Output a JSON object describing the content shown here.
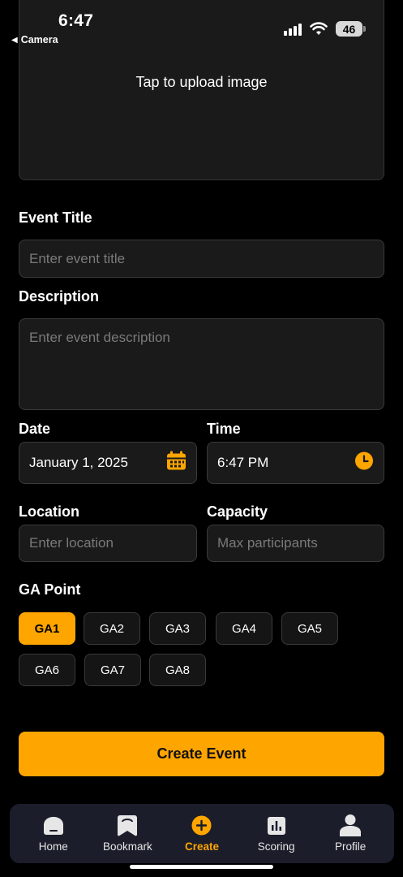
{
  "status": {
    "time": "6:47",
    "back_app": "Camera",
    "battery": "46"
  },
  "upload": {
    "prompt": "Tap to upload image"
  },
  "form": {
    "event_title": {
      "label": "Event Title",
      "placeholder": "Enter event title"
    },
    "description": {
      "label": "Description",
      "placeholder": "Enter event description"
    },
    "date": {
      "label": "Date",
      "value": "January 1, 2025",
      "icon": "calendar-icon"
    },
    "time": {
      "label": "Time",
      "value": "6:47 PM",
      "icon": "clock-icon"
    },
    "location": {
      "label": "Location",
      "placeholder": "Enter location"
    },
    "capacity": {
      "label": "Capacity",
      "placeholder": "Max participants"
    },
    "ga_point": {
      "label": "GA Point",
      "options": [
        "GA1",
        "GA2",
        "GA3",
        "GA4",
        "GA5",
        "GA6",
        "GA7",
        "GA8"
      ],
      "selected": "GA1"
    }
  },
  "actions": {
    "create_label": "Create Event"
  },
  "tabbar": {
    "items": [
      {
        "label": "Home",
        "icon": "home-icon"
      },
      {
        "label": "Bookmark",
        "icon": "bookmark-icon"
      },
      {
        "label": "Create",
        "icon": "plus-circle-icon",
        "active": true
      },
      {
        "label": "Scoring",
        "icon": "bar-chart-icon"
      },
      {
        "label": "Profile",
        "icon": "person-icon"
      }
    ]
  },
  "colors": {
    "accent": "#ffa500",
    "background": "#000000",
    "field_bg": "#1a1a1a",
    "tabbar_bg": "#1b1d2a"
  }
}
